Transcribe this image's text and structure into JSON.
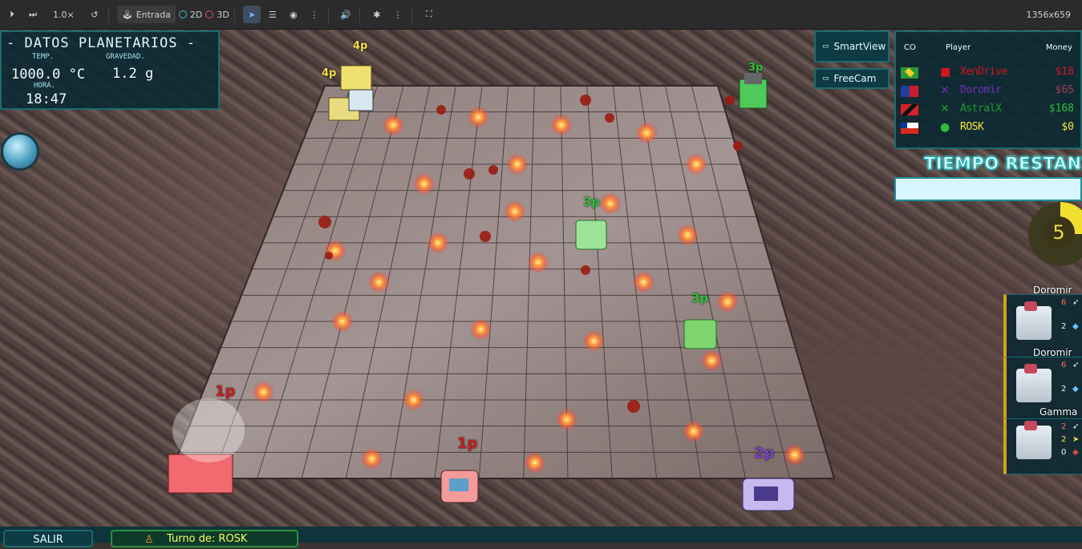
{
  "toolbar": {
    "speed": "1.0×",
    "input_label": "Entrada",
    "mode_2d": "2D",
    "mode_3d": "3D",
    "resolution": "1356x659"
  },
  "planet": {
    "title": "- DATOS PLANETARIOS -",
    "temp_label": "TEMP.",
    "temp_value": "1000.0 °C",
    "gravity_label": "GRAVEDAD.",
    "gravity_value": "1.2 g",
    "time_label": "HORA.",
    "time_value": "18:47"
  },
  "camera": {
    "smartview": "SmartView",
    "freecam": "FreeCam"
  },
  "scoreboard": {
    "col_co": "CO",
    "col_player": "Player",
    "col_money": "Money",
    "rows": [
      {
        "name": "XenDrive",
        "money": "$18",
        "color": "#d0161e",
        "flag": "brazil"
      },
      {
        "name": "Doromir",
        "money": "$65",
        "color": "#6d2fb5",
        "flag": "dominican"
      },
      {
        "name": "AstralX",
        "money": "$168",
        "color": "#1e9b2a",
        "flag": "trinidad"
      },
      {
        "name": "ROSK",
        "money": "$0",
        "color": "#f3e83a",
        "flag": "chile"
      }
    ]
  },
  "timer": {
    "title": "TIEMPO RESTANTE",
    "seconds": "5",
    "fraction_remaining": 0.25
  },
  "units": [
    {
      "name": "Doromir",
      "attack": "6",
      "defense": "2"
    },
    {
      "name": "Doromir",
      "attack": "6",
      "defense": "2"
    },
    {
      "name": "Gamma",
      "attack": "2",
      "speed": "2",
      "defense": "0"
    }
  ],
  "board_tags": [
    {
      "text": "4p",
      "color": "#f4e04a"
    },
    {
      "text": "4p",
      "color": "#f4e04a"
    },
    {
      "text": "3p",
      "color": "#2fbf3a"
    },
    {
      "text": "3p",
      "color": "#2fbf3a"
    },
    {
      "text": "3p",
      "color": "#2fbf3a"
    },
    {
      "text": "1p",
      "color": "#c42020"
    },
    {
      "text": "1p",
      "color": "#c42020"
    },
    {
      "text": "2p",
      "color": "#7a3fc4"
    }
  ],
  "bottom": {
    "exit": "SALIR",
    "turn": "Turno de: ROSK"
  }
}
